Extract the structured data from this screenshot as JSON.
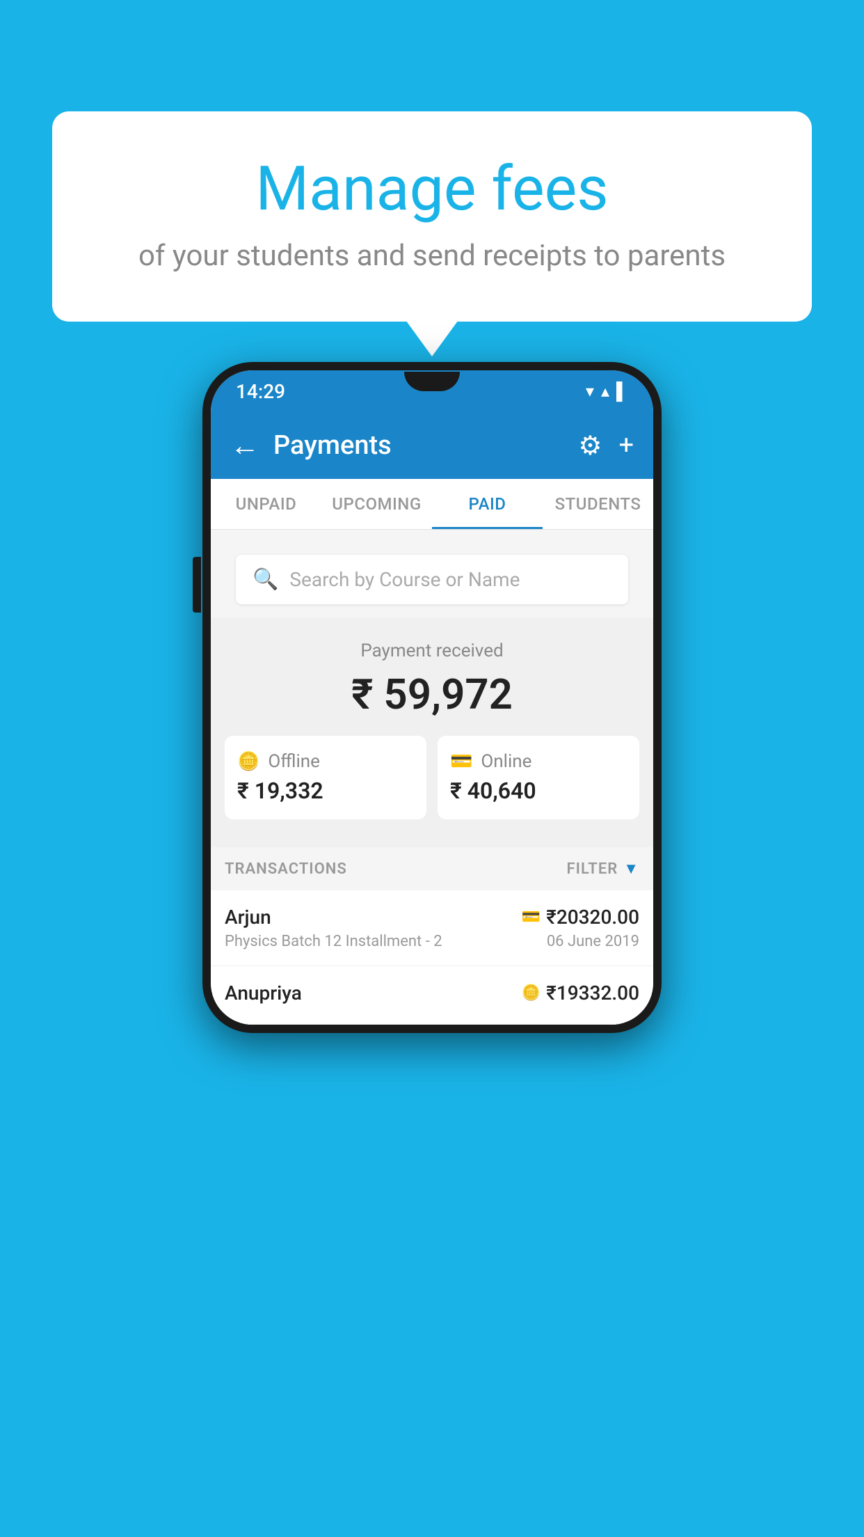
{
  "background_color": "#1ab3e8",
  "speech_bubble": {
    "title": "Manage fees",
    "subtitle": "of your students and send receipts to parents"
  },
  "status_bar": {
    "time": "14:29",
    "icons": "▾ ▴ ▌"
  },
  "app_bar": {
    "title": "Payments",
    "back_label": "←",
    "settings_label": "⚙",
    "add_label": "+"
  },
  "tabs": [
    {
      "label": "UNPAID",
      "active": false
    },
    {
      "label": "UPCOMING",
      "active": false
    },
    {
      "label": "PAID",
      "active": true
    },
    {
      "label": "STUDENTS",
      "active": false
    }
  ],
  "search": {
    "placeholder": "Search by Course or Name"
  },
  "summary": {
    "label": "Payment received",
    "amount": "₹ 59,972",
    "offline_label": "Offline",
    "offline_amount": "₹ 19,332",
    "online_label": "Online",
    "online_amount": "₹ 40,640"
  },
  "transactions_section": {
    "label": "TRANSACTIONS",
    "filter_label": "FILTER"
  },
  "transactions": [
    {
      "name": "Arjun",
      "detail": "Physics Batch 12 Installment - 2",
      "amount": "₹20320.00",
      "date": "06 June 2019",
      "payment_type": "online"
    },
    {
      "name": "Anupriya",
      "detail": "",
      "amount": "₹19332.00",
      "date": "",
      "payment_type": "offline"
    }
  ]
}
